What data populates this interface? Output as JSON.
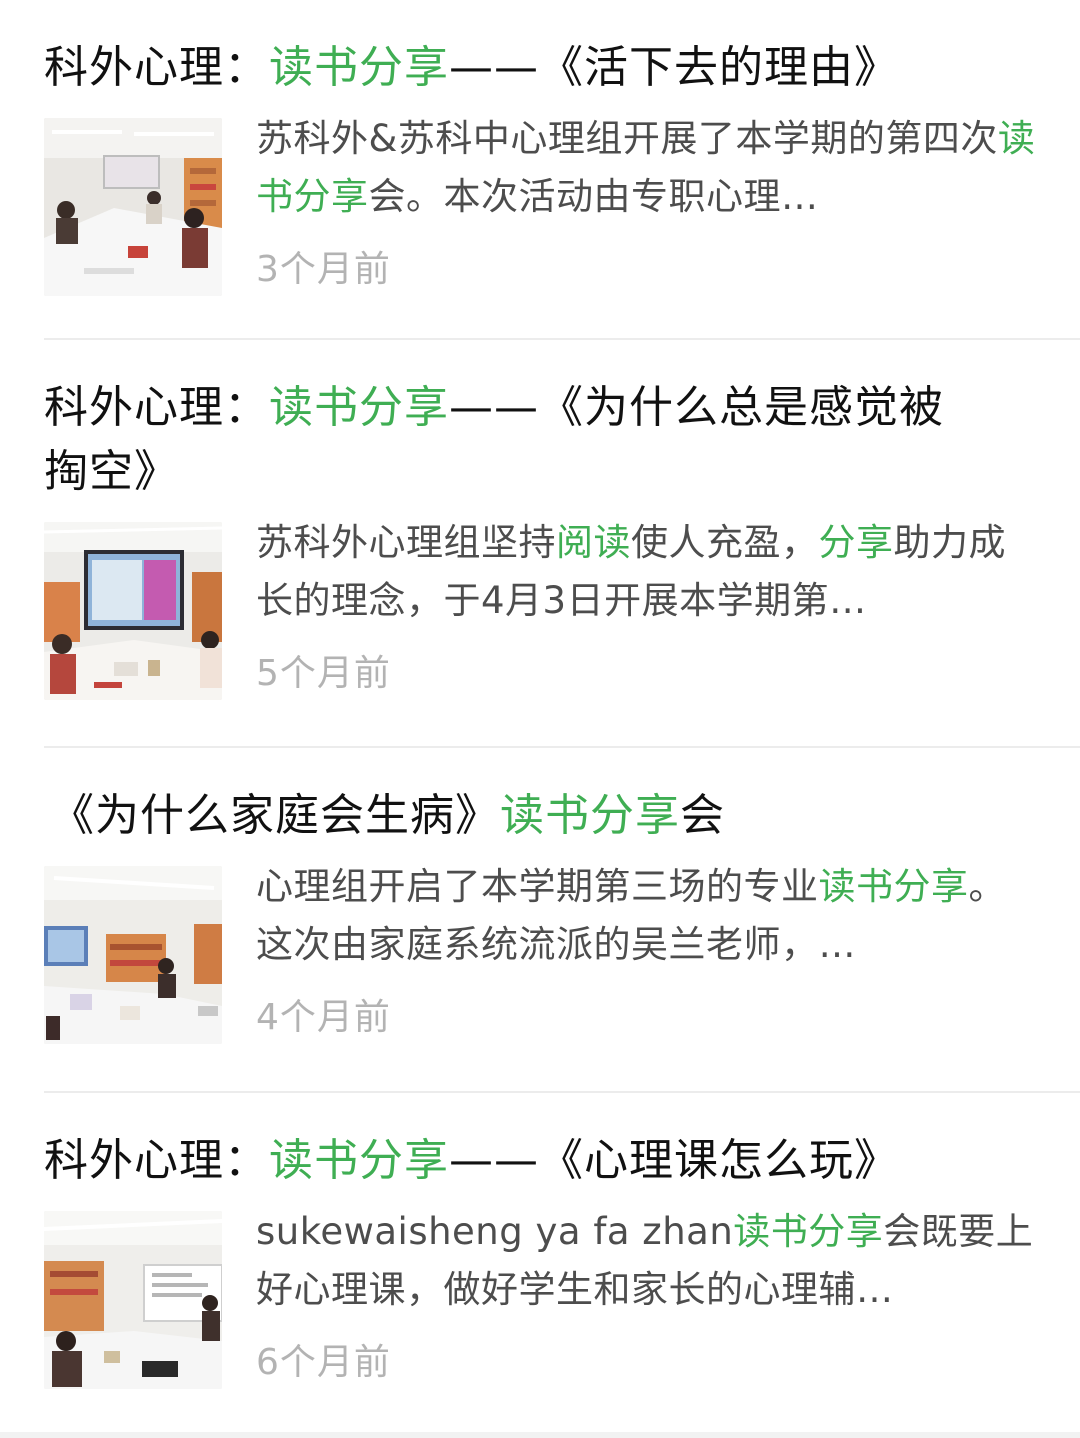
{
  "results": [
    {
      "title_parts": [
        "科外心理：",
        "读书分享",
        "——《活下去的理由》"
      ],
      "snippet_parts": [
        "苏科外&苏科中心理组开展了本学期的第四次",
        "读书分享",
        "会。本次活动由专职心理…"
      ],
      "time": "3个月前",
      "thumb_icon": "meeting-room-photo"
    },
    {
      "title_parts": [
        "科外心理：",
        "读书分享",
        "——《为什么总是感觉被掏空》"
      ],
      "snippet_parts": [
        "苏科外心理组坚持",
        "阅读",
        "使人充盈，",
        "分享",
        "助力成长的理念，于4月3日开展本学期第…"
      ],
      "time": "5个月前",
      "thumb_icon": "meeting-room-photo"
    },
    {
      "title_parts": [
        "《为什么家庭会生病》",
        "读书分享",
        "会"
      ],
      "snippet_parts": [
        "心理组开启了本学期第三场的专业",
        "读书分享",
        "。这次由家庭系统流派的吴兰老师，…"
      ],
      "time": "4个月前",
      "thumb_icon": "meeting-room-photo"
    },
    {
      "title_parts": [
        "科外心理：",
        "读书分享",
        "——《心理课怎么玩》"
      ],
      "snippet_parts": [
        "sukewaisheng ya fa zhan",
        "读书分享",
        "会既要上好心理课，做好学生和家长的心理辅…"
      ],
      "time": "6个月前",
      "thumb_icon": "meeting-room-photo"
    }
  ],
  "colors": {
    "highlight": "#3fae53",
    "title": "#111111",
    "snippet": "#4d4d4d",
    "time": "#b3b3b3",
    "divider": "#ececec"
  }
}
